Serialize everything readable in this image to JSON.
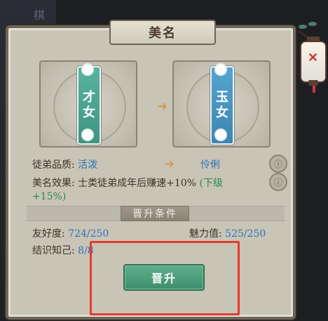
{
  "bg_char": "棋",
  "panel_title": "美名",
  "left_banner": [
    "才",
    "女"
  ],
  "right_banner": [
    "玉",
    "女"
  ],
  "quality_label": "徒弟品质:",
  "quality_from": "活泼",
  "quality_to": "伶俐",
  "effect_label": "美名效果:",
  "effect_text_part1": "士类徒弟成年后赚速+10%",
  "effect_text_part2": "(下级",
  "effect_text_part3": "+15%)",
  "upgrade_conditions": "晋升条件",
  "friendliness_label": "友好度:",
  "friendliness_value": "724/250",
  "charm_label": "魅力值:",
  "charm_value": "525/250",
  "acquaintance_label": "结识知己:",
  "acquaintance_value": "8/8",
  "primary_button": "晋升",
  "icons": {
    "info_icon_1": "info-circle",
    "info_icon_2": "info-circle",
    "arrow_icon": "arrow-right",
    "lamp_icon": "lantern"
  },
  "colors": {
    "accent_green": "#3e8e6d",
    "accent_blue": "#2f73b8",
    "red_outline": "#e43b2f"
  }
}
